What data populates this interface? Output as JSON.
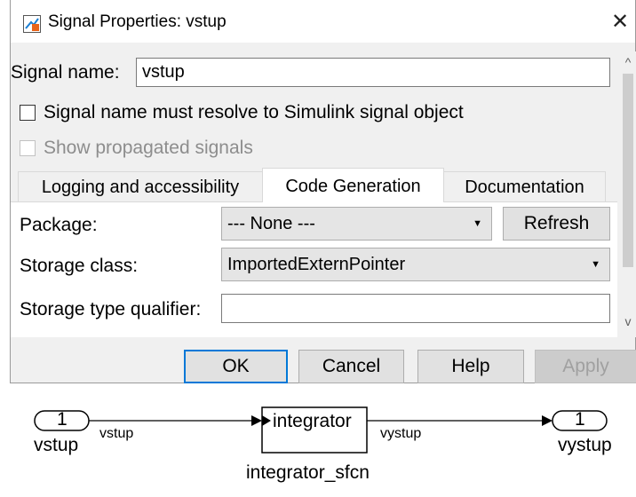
{
  "dialog": {
    "title": "Signal Properties: vstup",
    "close_glyph": "✕",
    "signal_name_label": "Signal name:",
    "signal_name_value": "vstup",
    "resolve_checkbox_label": "Signal name must resolve to Simulink signal object",
    "resolve_checked": false,
    "show_propagated_label": "Show propagated signals",
    "show_propagated_enabled": false,
    "tabs": [
      {
        "label": "Logging and accessibility",
        "active": false
      },
      {
        "label": "Code Generation",
        "active": true
      },
      {
        "label": "Documentation",
        "active": false
      }
    ],
    "package_label": "Package:",
    "package_value": "--- None ---",
    "refresh_label": "Refresh",
    "storage_class_label": "Storage class:",
    "storage_class_value": "ImportedExternPointer",
    "storage_qualifier_label": "Storage type qualifier:",
    "storage_qualifier_value": "",
    "buttons": {
      "ok": "OK",
      "cancel": "Cancel",
      "help": "Help",
      "apply": "Apply"
    },
    "accent_color": "#0078d7"
  },
  "diagram": {
    "inport_number": "1",
    "inport_name": "vstup",
    "input_signal": "vstup",
    "block_label": "integrator",
    "block_name": "integrator_sfcn",
    "output_signal": "vystup",
    "outport_number": "1",
    "outport_name": "vystup"
  }
}
